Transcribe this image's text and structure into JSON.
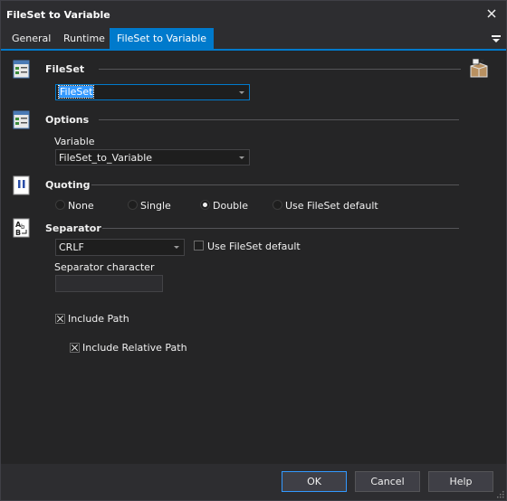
{
  "window": {
    "title": "FileSet to Variable"
  },
  "tabs": [
    {
      "label": "General",
      "active": false
    },
    {
      "label": "Runtime",
      "active": false
    },
    {
      "label": "FileSet to Variable",
      "active": true
    }
  ],
  "fileset_section": {
    "title": "FileSet",
    "value": "FileSet"
  },
  "options_section": {
    "title": "Options",
    "variable_label": "Variable",
    "variable_value": "FileSet_to_Variable"
  },
  "quoting_section": {
    "title": "Quoting",
    "options": [
      "None",
      "Single",
      "Double",
      "Use FileSet default"
    ],
    "selected": "Double"
  },
  "separator_section": {
    "title": "Separator",
    "value": "CRLF",
    "use_default_label": "Use FileSet default",
    "use_default_checked": false,
    "char_label": "Separator character",
    "char_value": "",
    "include_path_label": "Include Path",
    "include_path_checked": true,
    "include_relative_label": "Include Relative Path",
    "include_relative_checked": true
  },
  "footer": {
    "ok_label": "OK",
    "cancel_label": "Cancel",
    "help_label": "Help"
  },
  "icons": {
    "close": "close-icon",
    "tab_menu": "tab-menu-icon",
    "fileset": "fileset-icon",
    "options": "options-icon",
    "quoting": "quote-icon",
    "separator": "separator-icon",
    "variable_inspector": "variable-inspector-icon"
  },
  "colors": {
    "accent": "#007acc",
    "background": "#2d2d30",
    "panel": "#252526",
    "text": "#f0f0f0",
    "selection": "#3399ff"
  }
}
